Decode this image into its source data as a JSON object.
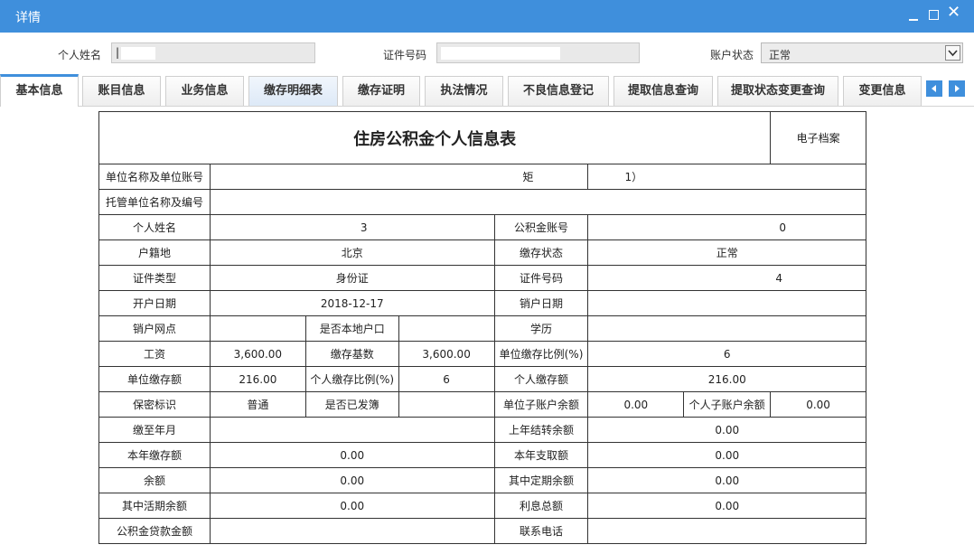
{
  "window": {
    "title": "详情"
  },
  "filter": {
    "name_label": "个人姓名",
    "name_value": "|",
    "id_label": "证件号码",
    "status_label": "账户状态",
    "status_value": "正常"
  },
  "tabs": [
    "基本信息",
    "账目信息",
    "业务信息",
    "缴存明细表",
    "缴存证明",
    "执法情况",
    "不良信息登记",
    "提取信息查询",
    "提取状态变更查询",
    "变更信息"
  ],
  "sheet": {
    "title": "住房公积金个人信息表",
    "archive": "电子档案",
    "r1": {
      "l": "单位名称及单位账号",
      "v1": "矩",
      "v2": "1）"
    },
    "r2": {
      "l": "托管单位名称及编号",
      "v": ""
    },
    "r3": {
      "l1": "个人姓名",
      "v1": "3",
      "l2": "公积金账号",
      "v2": "0"
    },
    "r4": {
      "l1": "户籍地",
      "v1": "北京",
      "l2": "缴存状态",
      "v2": "正常"
    },
    "r5": {
      "l1": "证件类型",
      "v1": "身份证",
      "l2": "证件号码",
      "v2": "4"
    },
    "r6": {
      "l1": "开户日期",
      "v1": "2018-12-17",
      "l2": "销户日期",
      "v2": ""
    },
    "r7": {
      "l1": "销户网点",
      "v1": "",
      "l2": "是否本地户口",
      "v2": "",
      "l3": "学历",
      "v3": ""
    },
    "r8": {
      "l1": "工资",
      "v1": "3,600.00",
      "l2": "缴存基数",
      "v2": "3,600.00",
      "l3": "单位缴存比例(%)",
      "v3": "6"
    },
    "r9": {
      "l1": "单位缴存额",
      "v1": "216.00",
      "l2": "个人缴存比例(%)",
      "v2": "6",
      "l3": "个人缴存额",
      "v3": "216.00"
    },
    "r10": {
      "l1": "保密标识",
      "v1": "普通",
      "l2": "是否已发簿",
      "v2": "",
      "l3": "单位子账户余额",
      "v3": "0.00",
      "l4": "个人子账户余额",
      "v4": "0.00"
    },
    "r11": {
      "l1": "缴至年月",
      "v1": "",
      "l2": "上年结转余额",
      "v2": "0.00"
    },
    "r12": {
      "l1": "本年缴存额",
      "v1": "0.00",
      "l2": "本年支取额",
      "v2": "0.00"
    },
    "r13": {
      "l1": "余额",
      "v1": "0.00",
      "l2": "其中定期余额",
      "v2": "0.00"
    },
    "r14": {
      "l1": "其中活期余额",
      "v1": "0.00",
      "l2": "利息总额",
      "v2": "0.00"
    },
    "r15": {
      "l1": "公积金贷款金额",
      "v1": "",
      "l2": "联系电话",
      "v2": ""
    }
  }
}
